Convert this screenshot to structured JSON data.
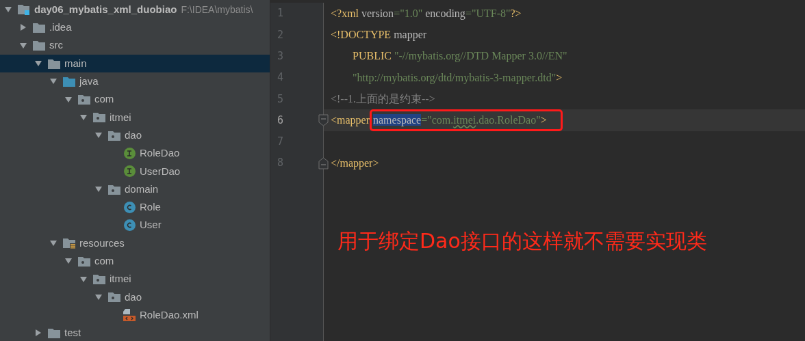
{
  "project_tree": {
    "label": "day06_mybatis_xml_duobiao",
    "hint": "F:\\IDEA\\mybatis\\",
    "kind": "module",
    "expanded": true,
    "selected": false,
    "children": [
      {
        "label": ".idea",
        "kind": "folder",
        "expanded": false,
        "selected": false
      },
      {
        "label": "src",
        "kind": "folder",
        "expanded": true,
        "selected": false,
        "children": [
          {
            "label": "main",
            "kind": "folder",
            "expanded": true,
            "selected": true,
            "children": [
              {
                "label": "java",
                "kind": "source",
                "expanded": true,
                "selected": false,
                "children": [
                  {
                    "label": "com",
                    "kind": "package",
                    "expanded": true,
                    "selected": false,
                    "children": [
                      {
                        "label": "itmei",
                        "kind": "package",
                        "expanded": true,
                        "selected": false,
                        "children": [
                          {
                            "label": "dao",
                            "kind": "package",
                            "expanded": true,
                            "selected": false,
                            "children": [
                              {
                                "label": "RoleDao",
                                "kind": "interface",
                                "selected": false
                              },
                              {
                                "label": "UserDao",
                                "kind": "interface",
                                "selected": false
                              }
                            ]
                          },
                          {
                            "label": "domain",
                            "kind": "package",
                            "expanded": true,
                            "selected": false,
                            "children": [
                              {
                                "label": "Role",
                                "kind": "class",
                                "selected": false
                              },
                              {
                                "label": "User",
                                "kind": "class",
                                "selected": false
                              }
                            ]
                          }
                        ]
                      }
                    ]
                  }
                ]
              },
              {
                "label": "resources",
                "kind": "resources",
                "expanded": true,
                "selected": false,
                "children": [
                  {
                    "label": "com",
                    "kind": "package",
                    "expanded": true,
                    "selected": false,
                    "children": [
                      {
                        "label": "itmei",
                        "kind": "package",
                        "expanded": true,
                        "selected": false,
                        "children": [
                          {
                            "label": "dao",
                            "kind": "package",
                            "expanded": true,
                            "selected": false,
                            "children": [
                              {
                                "label": "RoleDao.xml",
                                "kind": "xml",
                                "selected": false
                              }
                            ]
                          }
                        ]
                      }
                    ]
                  }
                ]
              }
            ]
          },
          {
            "label": "test",
            "kind": "folder",
            "expanded": false,
            "selected": false
          }
        ]
      }
    ]
  },
  "editor": {
    "lines": [
      {
        "number": "1",
        "current": false,
        "kind": "plain",
        "tokens": [
          {
            "text": "<?xml ",
            "kind": "punct"
          },
          {
            "text": "version",
            "kind": "attr"
          },
          {
            "text": "=\"1.0\"",
            "kind": "value"
          },
          {
            "text": " encoding",
            "kind": "attr"
          },
          {
            "text": "=\"UTF-8\"",
            "kind": "value"
          },
          {
            "text": "?>",
            "kind": "punct"
          }
        ]
      },
      {
        "number": "2",
        "current": false,
        "kind": "plain",
        "tokens": [
          {
            "text": "<!",
            "kind": "punct"
          },
          {
            "text": "DOCTYPE",
            "kind": "tag"
          },
          {
            "text": " mapper",
            "kind": "attr"
          }
        ]
      },
      {
        "number": "3",
        "current": false,
        "kind": "plain",
        "tokens": [
          {
            "text": "        PUBLIC ",
            "kind": "tag"
          },
          {
            "text": "\"-//mybatis.org//DTD Mapper 3.0//EN\"",
            "kind": "value"
          }
        ]
      },
      {
        "number": "4",
        "current": false,
        "kind": "plain",
        "tokens": [
          {
            "text": "        \"http://mybatis.org/dtd/mybatis-3-mapper.dtd\"",
            "kind": "value"
          },
          {
            "text": ">",
            "kind": "punct"
          }
        ]
      },
      {
        "number": "5",
        "current": false,
        "kind": "plain",
        "tokens": [
          {
            "text": "<!--1.上面的是约束-->",
            "kind": "comment"
          }
        ]
      },
      {
        "number": "6",
        "current": true,
        "kind": "fold-start",
        "tokens": [
          {
            "text": "<",
            "kind": "punct"
          },
          {
            "text": "mapper ",
            "kind": "tag"
          }
        ],
        "framed_tokens": [
          {
            "text": "namespace",
            "kind": "attr",
            "selected": true
          },
          {
            "text": "=\"com.",
            "kind": "value"
          },
          {
            "text": "itmei",
            "kind": "value",
            "typo": true
          },
          {
            "text": ".dao.RoleDao\"",
            "kind": "value"
          },
          {
            "text": ">",
            "kind": "punct"
          }
        ]
      },
      {
        "number": "7",
        "current": false,
        "kind": "plain"
      },
      {
        "number": "8",
        "current": false,
        "kind": "fold-end",
        "tokens": [
          {
            "text": "</",
            "kind": "punct"
          },
          {
            "text": "mapper",
            "kind": "tag"
          },
          {
            "text": ">",
            "kind": "punct"
          }
        ]
      }
    ],
    "annotation": "用于绑定Dao接口的这样就不需要实现类"
  }
}
